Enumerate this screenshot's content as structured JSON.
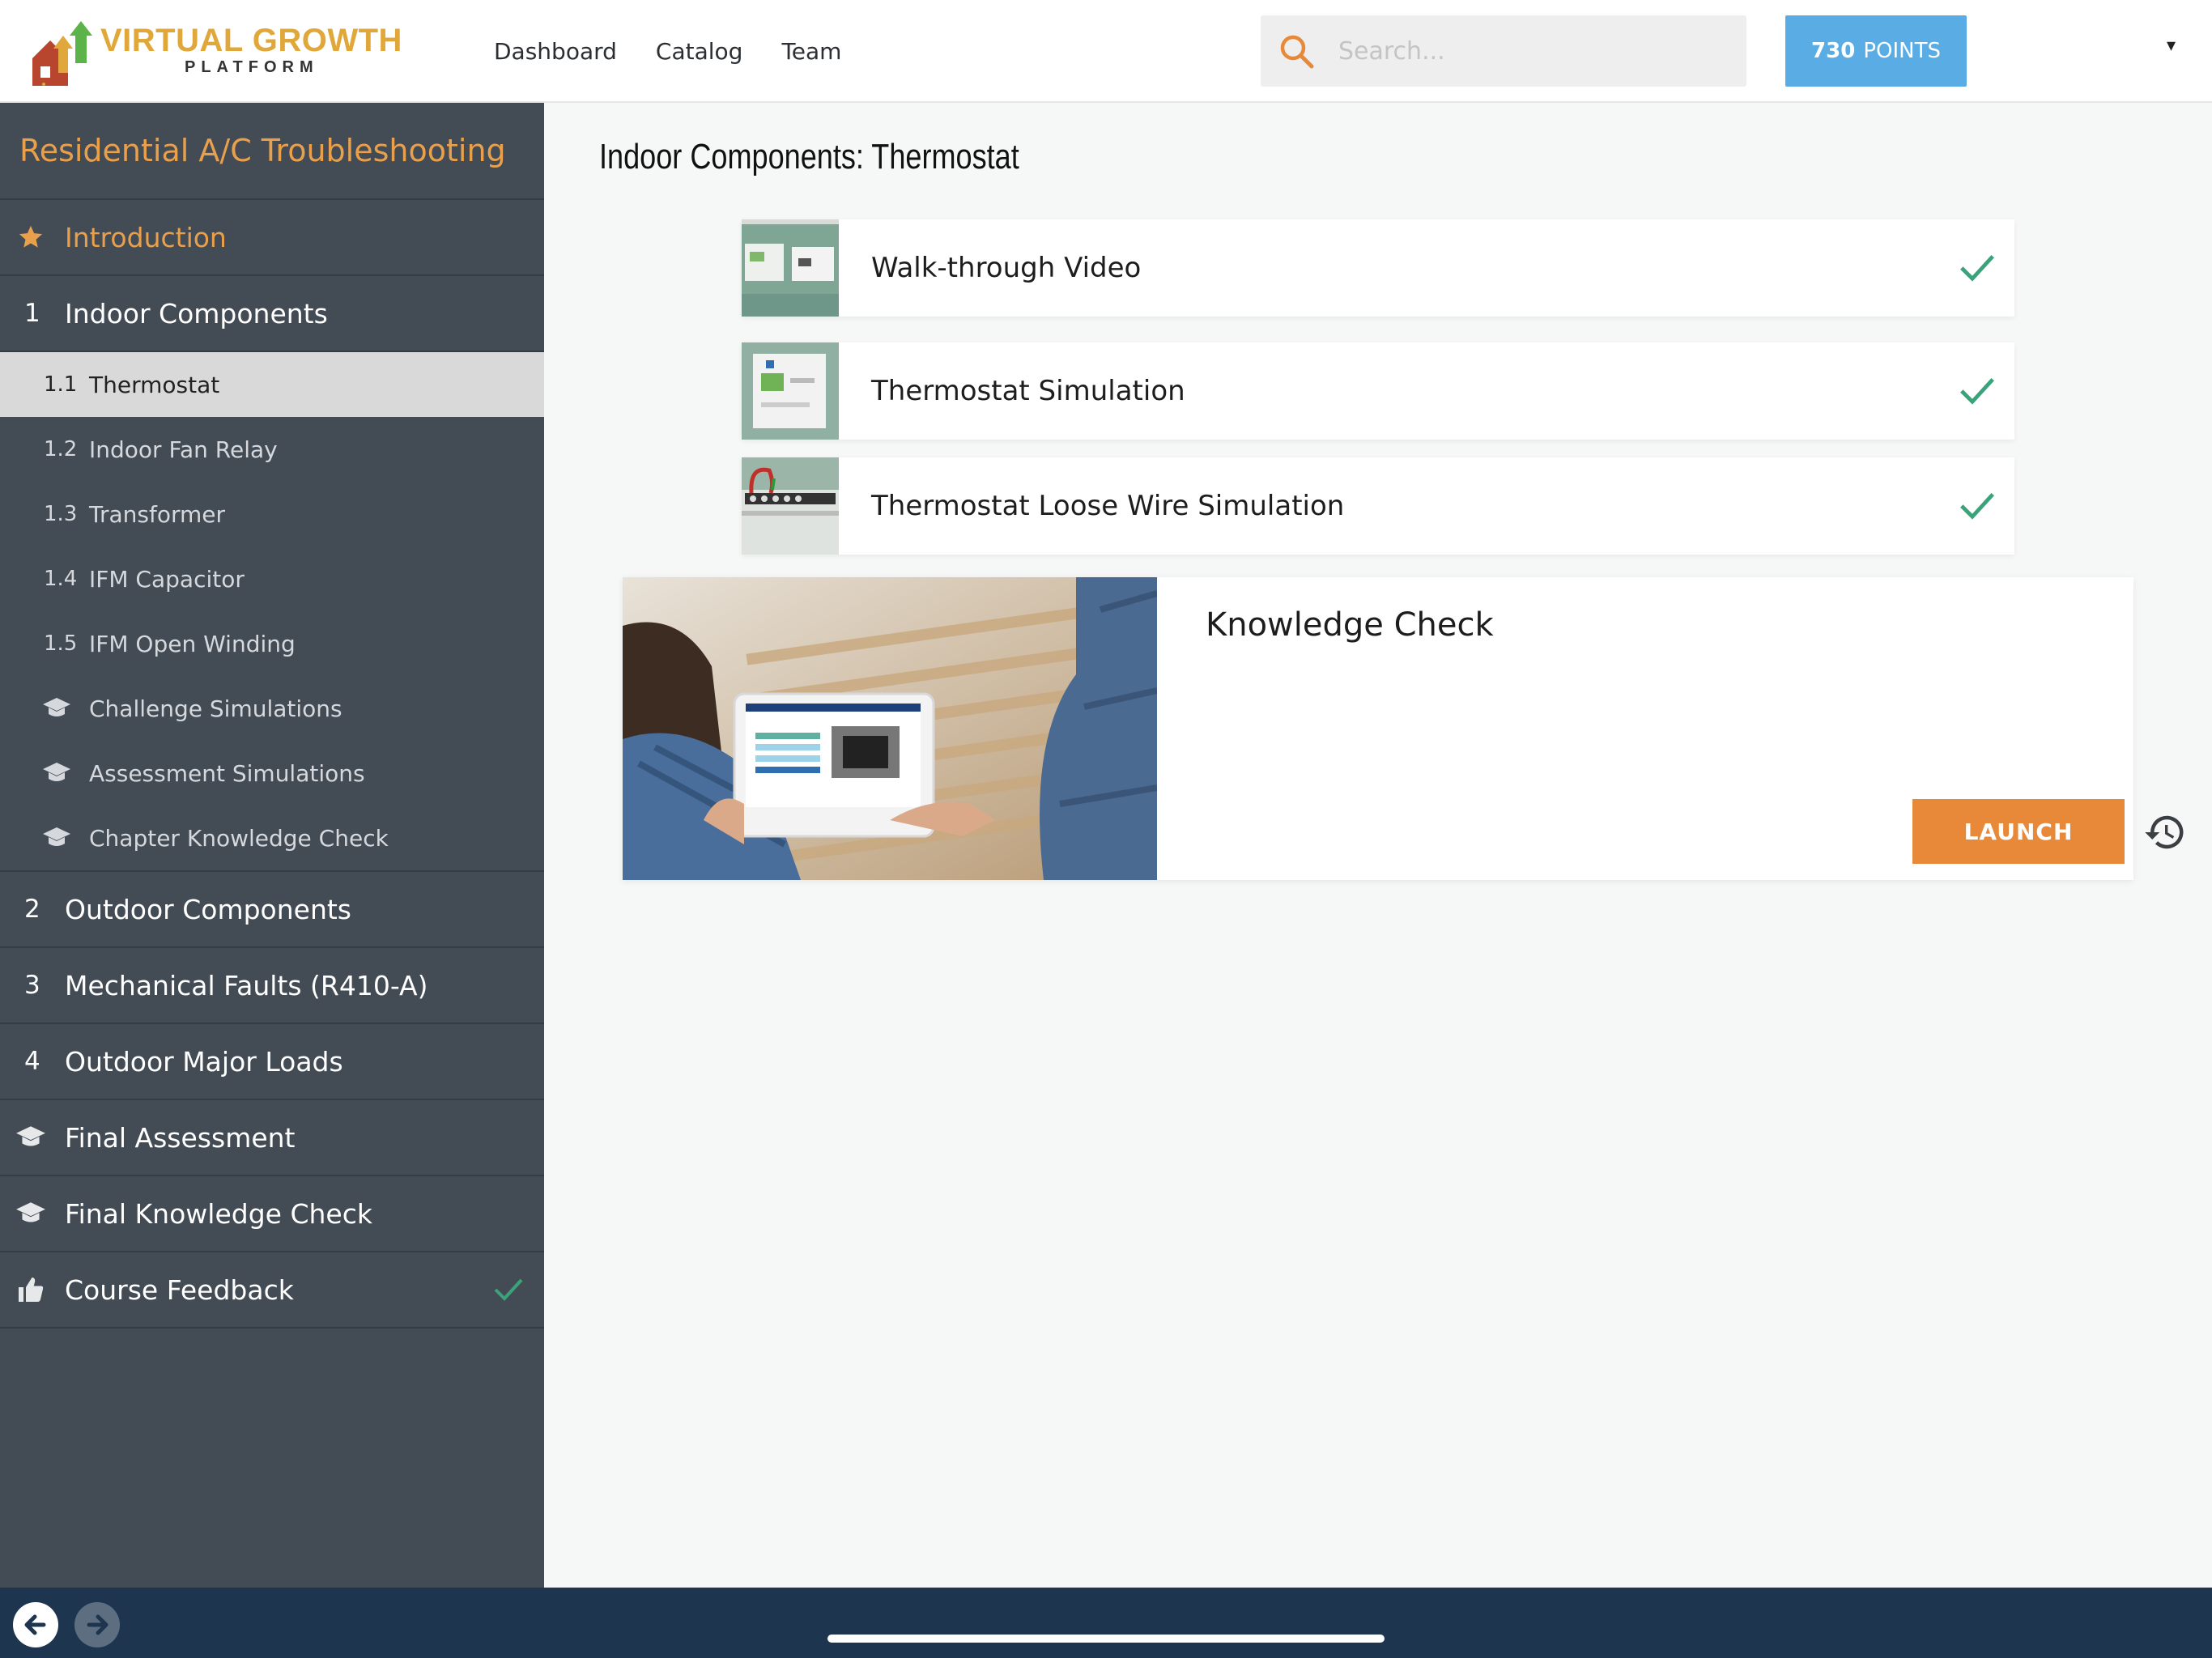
{
  "logo": {
    "title": "VIRTUAL GROWTH",
    "subtitle": "PLATFORM"
  },
  "nav": {
    "links": [
      "Dashboard",
      "Catalog",
      "Team"
    ]
  },
  "search": {
    "placeholder": "Search...",
    "value": ""
  },
  "points": {
    "value": "730",
    "label": "POINTS"
  },
  "user_menu": {
    "caret": "▾"
  },
  "sidebar": {
    "course_title": "Residential A/C Troubleshooting",
    "intro": {
      "label": "Introduction",
      "icon": "star-icon"
    },
    "chapter1": {
      "num": "1",
      "label": "Indoor Components"
    },
    "sub_items": [
      {
        "num": "1.1",
        "label": "Thermostat",
        "active": true
      },
      {
        "num": "1.2",
        "label": "Indoor Fan Relay"
      },
      {
        "num": "1.3",
        "label": "Transformer"
      },
      {
        "num": "1.4",
        "label": "IFM Capacitor"
      },
      {
        "num": "1.5",
        "label": "IFM Open Winding"
      },
      {
        "icon": "graduation-cap-icon",
        "label": "Challenge Simulations"
      },
      {
        "icon": "graduation-cap-icon",
        "label": "Assessment Simulations"
      },
      {
        "icon": "graduation-cap-icon",
        "label": "Chapter Knowledge Check"
      }
    ],
    "chapters": [
      {
        "num": "2",
        "label": "Outdoor Components"
      },
      {
        "num": "3",
        "label": "Mechanical Faults (R410-A)"
      },
      {
        "num": "4",
        "label": "Outdoor Major Loads"
      }
    ],
    "final_assessment": {
      "label": "Final Assessment",
      "icon": "graduation-cap-icon"
    },
    "final_knowledge_check": {
      "label": "Final Knowledge Check",
      "icon": "graduation-cap-icon"
    },
    "course_feedback": {
      "label": "Course Feedback",
      "icon": "thumbs-up-icon",
      "completed": true
    }
  },
  "main": {
    "page_title": "Indoor Components: Thermostat",
    "activities": [
      {
        "label": "Walk-through Video",
        "completed": true
      },
      {
        "label": "Thermostat Simulation",
        "completed": true
      },
      {
        "label": "Thermostat Loose Wire Simulation",
        "completed": true
      }
    ],
    "knowledge_check": {
      "title": "Knowledge Check",
      "launch_label": "LAUNCH"
    }
  },
  "colors": {
    "accent_orange": "#e8893a",
    "points_blue": "#5aade4",
    "sidebar_bg": "#434b54",
    "check_green": "#3aa37a",
    "bottom_bar": "#1e3550"
  }
}
